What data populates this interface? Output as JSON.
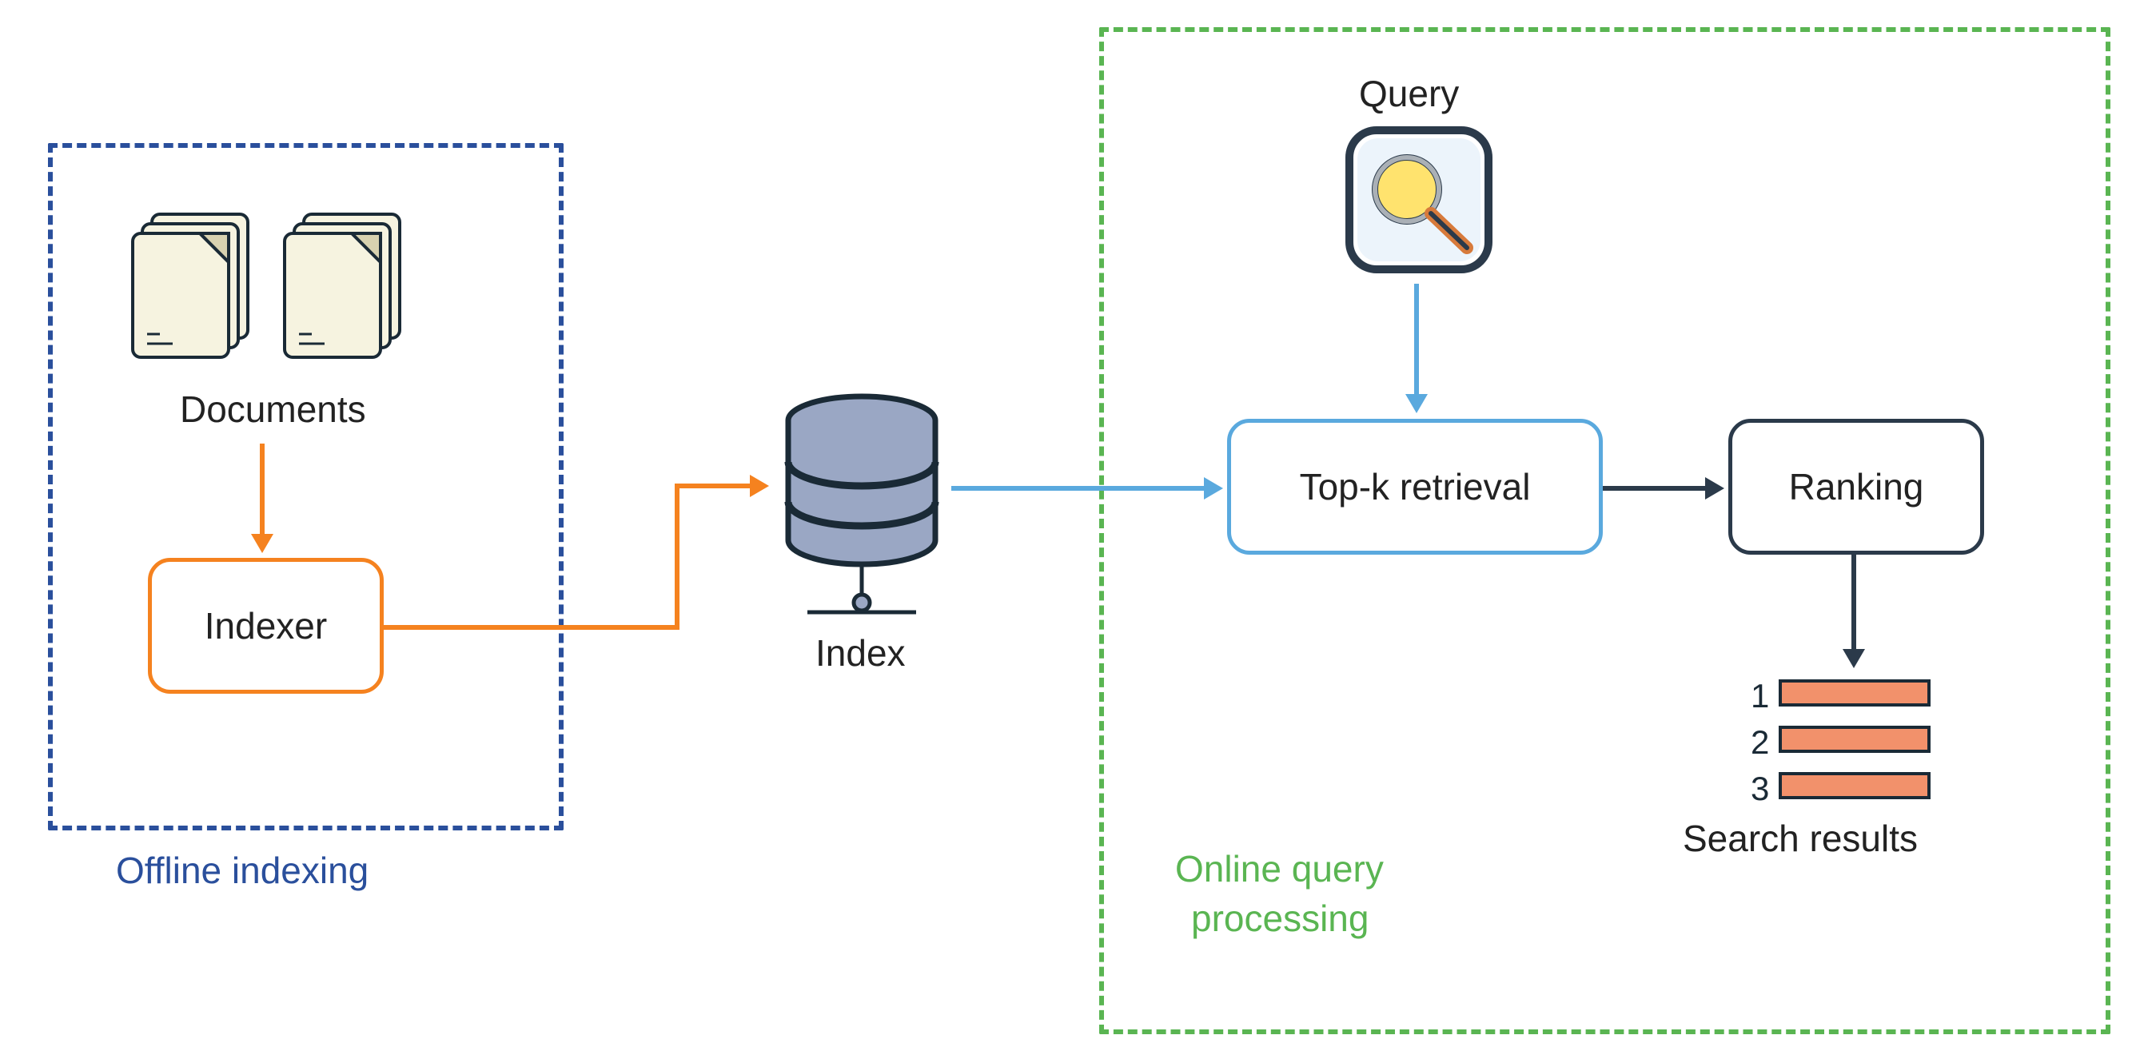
{
  "labels": {
    "documents": "Documents",
    "indexer": "Indexer",
    "index": "Index",
    "query": "Query",
    "topk": "Top-k retrieval",
    "ranking": "Ranking",
    "search_results": "Search results",
    "offline_indexing": "Offline indexing",
    "online_processing_line1": "Online query",
    "online_processing_line2": "processing"
  },
  "regions": {
    "offline": "offline-indexing-region",
    "online": "online-query-processing-region"
  },
  "nodes": {
    "documents": "documents-node",
    "indexer": "indexer-node",
    "index": "index-node",
    "query": "query-node",
    "topk": "topk-retrieval-node",
    "ranking": "ranking-node",
    "results": "search-results-node"
  },
  "flow": [
    {
      "from": "documents",
      "to": "indexer",
      "color": "orange"
    },
    {
      "from": "indexer",
      "to": "index",
      "color": "orange"
    },
    {
      "from": "index",
      "to": "topk",
      "color": "lightblue"
    },
    {
      "from": "query",
      "to": "topk",
      "color": "lightblue"
    },
    {
      "from": "topk",
      "to": "ranking",
      "color": "navy"
    },
    {
      "from": "ranking",
      "to": "results",
      "color": "navy"
    }
  ],
  "results": {
    "ranks": [
      "1",
      "2",
      "3"
    ]
  },
  "colors": {
    "orange": "#f5821f",
    "lightblue": "#5aa9de",
    "navy": "#2b3a4a",
    "region_blue": "#2a4f9c",
    "region_green": "#5ab552",
    "result_fill": "#f2916b"
  }
}
